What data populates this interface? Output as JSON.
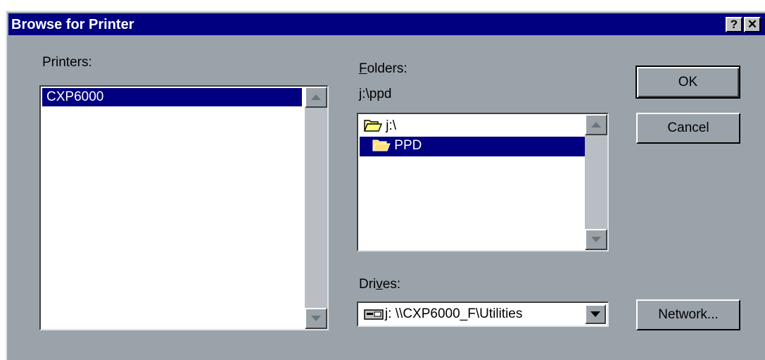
{
  "window": {
    "title": "Browse for Printer",
    "help_button": "?",
    "close_button": "✕"
  },
  "printers": {
    "label": "Printers:",
    "items": [
      "CXP6000"
    ],
    "selected": "CXP6000"
  },
  "folders": {
    "label_accel": "F",
    "label_rest": "olders:",
    "current_path": "j:\\ppd",
    "tree": [
      {
        "label": "j:\\",
        "icon": "open-folder-icon"
      },
      {
        "label": "PPD",
        "icon": "open-folder-icon",
        "selected": true
      }
    ]
  },
  "drives": {
    "label_pre": "Dri",
    "label_accel": "v",
    "label_post": "es:",
    "selected": "j: \\\\CXP6000_F\\Utilities",
    "icon": "network-drive-icon"
  },
  "buttons": {
    "ok": "OK",
    "cancel": "Cancel",
    "network": "Network..."
  },
  "colors": {
    "title_bar": "#000080",
    "dialog_face": "#9ba3aa",
    "selection": "#000080"
  }
}
